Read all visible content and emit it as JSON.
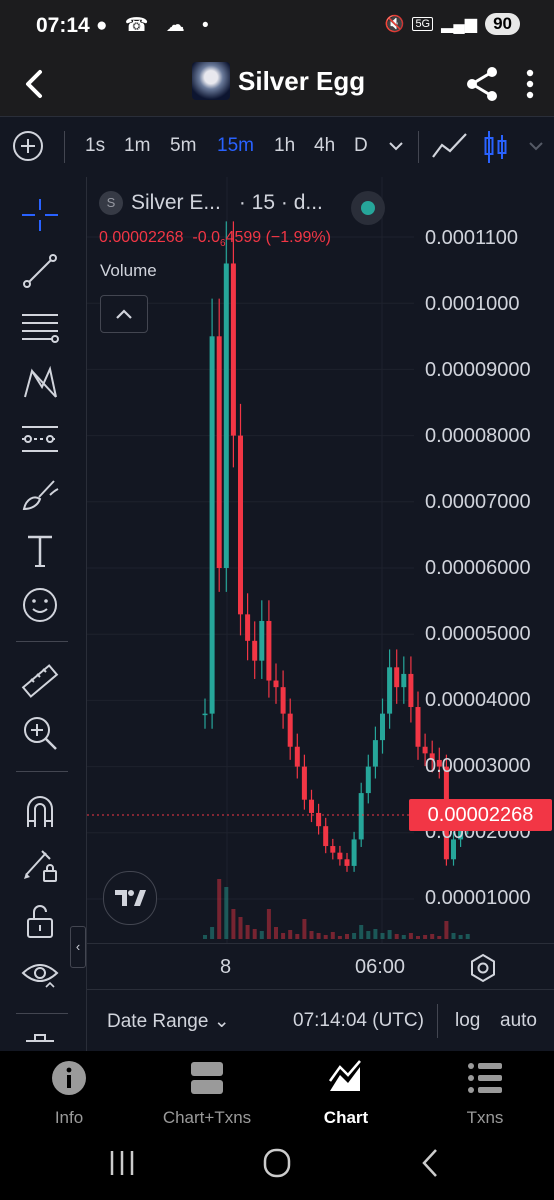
{
  "status_bar": {
    "time": "07:14",
    "net_label": "5G",
    "battery": "90"
  },
  "header": {
    "title": "Silver Egg"
  },
  "toolbar": {
    "intervals": [
      "1s",
      "1m",
      "5m",
      "15m",
      "1h",
      "4h",
      "D"
    ],
    "active_interval": "15m"
  },
  "legend": {
    "symbol_initial": "S",
    "symbol_name": "Silver E...",
    "meta": "· 15 · d...",
    "ohlc_value": "0.00002268",
    "ohlc_change_prefix": "-0.0",
    "ohlc_change_sub": "6",
    "ohlc_change_rest": "4599 (−1.99%)",
    "volume_label": "Volume"
  },
  "price_axis": {
    "labels": [
      "0.0001100",
      "0.0001000",
      "0.00009000",
      "0.00008000",
      "0.00007000",
      "0.00006000",
      "0.00005000",
      "0.00004000",
      "0.00003000",
      "0.00002000",
      "0.00001000"
    ],
    "current_price": "0.00002268"
  },
  "time_axis": {
    "labels": [
      "8",
      "06:00"
    ]
  },
  "footer": {
    "date_range": "Date Range",
    "clock": "07:14:04 (UTC)",
    "log": "log",
    "auto": "auto"
  },
  "bottom_nav": {
    "items": [
      {
        "label": "Info",
        "icon": "info-icon"
      },
      {
        "label": "Chart+Txns",
        "icon": "split-view-icon"
      },
      {
        "label": "Chart",
        "icon": "chart-icon"
      },
      {
        "label": "Txns",
        "icon": "list-icon"
      }
    ],
    "active": "Chart"
  },
  "chart_data": {
    "type": "candlestick",
    "ylim": [
      5e-06,
      0.000115
    ],
    "up_color": "#26a69a",
    "down_color": "#f23645",
    "close_path": [
      3.8e-05,
      9.5e-05,
      6e-05,
      0.000106,
      8e-05,
      5.3e-05,
      4.9e-05,
      4.6e-05,
      5.2e-05,
      4.3e-05,
      4.2e-05,
      3.8e-05,
      3.3e-05,
      3e-05,
      2.5e-05,
      2.3e-05,
      2.1e-05,
      1.8e-05,
      1.7e-05,
      1.6e-05,
      1.5e-05,
      1.9e-05,
      2.6e-05,
      3e-05,
      3.4e-05,
      3.8e-05,
      4.5e-05,
      4.2e-05,
      4.4e-05,
      3.9e-05,
      3.3e-05,
      3.2e-05,
      3.1e-05,
      3e-05,
      1.6e-05,
      1.9e-05,
      2.1e-05,
      2.268e-05
    ]
  }
}
